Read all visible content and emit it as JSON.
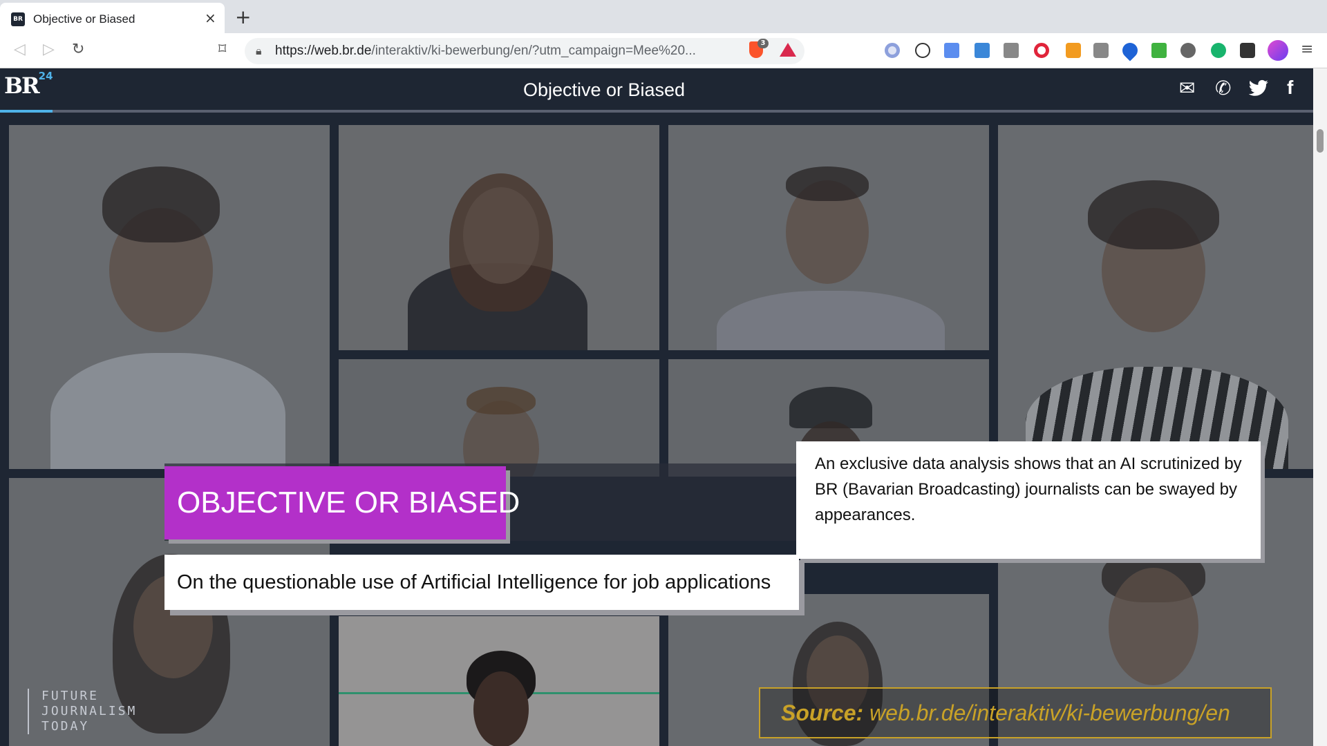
{
  "browser": {
    "tab_title": "Objective or Biased",
    "tab_favicon": "BR",
    "tab_close_icon": "×",
    "new_tab_icon": "+",
    "url_host": "https://web.br.de",
    "url_path": "/interaktiv/ki-bewerbung/en/?utm_campaign=Mee%20...",
    "shield_count": "3"
  },
  "site": {
    "logo_text": "BR",
    "logo_sup": "24",
    "header_title": "Objective or Biased",
    "share_icons": [
      "mail-icon",
      "whatsapp-icon",
      "twitter-icon",
      "facebook-icon"
    ],
    "reading_progress": 0.04,
    "accent_color": "#4fb2e8"
  },
  "hero": {
    "title": "OBJECTIVE OR BIASED",
    "subtitle": "On the questionable use of Artificial Intelligence for job applications",
    "lede": "An exclusive data analysis shows that an AI scrutinized by BR (Bavarian Broadcasting) journalists can be swayed by appearances.",
    "title_bg": "#b330c9"
  },
  "overlay": {
    "fjt_lines": [
      "FUTURE",
      "JOURNALISM",
      "TODAY"
    ],
    "source_label": "Source:",
    "source_url": "web.br.de/interaktiv/ki-bewerbung/en",
    "source_color": "#c9a227"
  }
}
